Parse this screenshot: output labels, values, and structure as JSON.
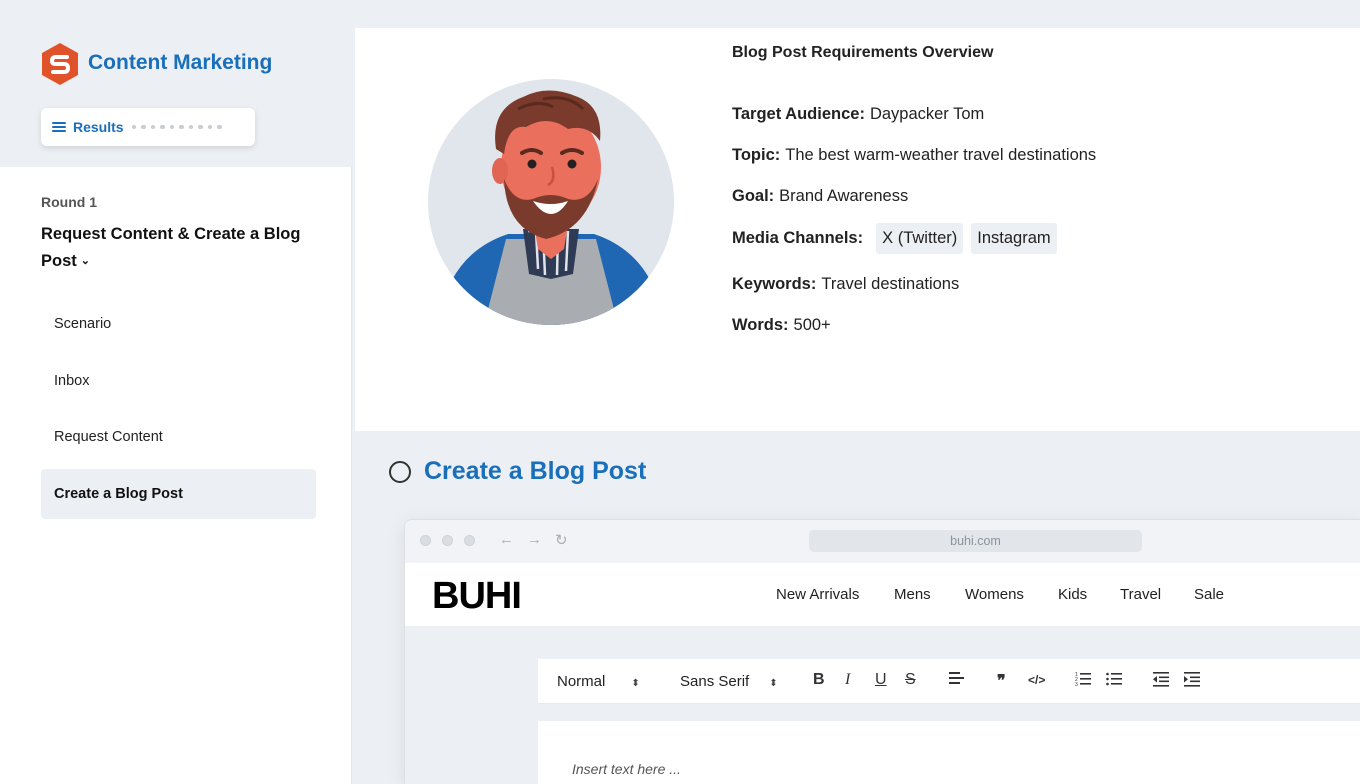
{
  "sidebar": {
    "app_title": "Content Marketing",
    "results_label": "Results",
    "round_label": "Round 1",
    "section_title": "Request Content & Create a Blog Post",
    "section_chevron": "⌄",
    "items": [
      {
        "label": "Scenario",
        "active": false
      },
      {
        "label": "Inbox",
        "active": false
      },
      {
        "label": "Request Content",
        "active": false
      },
      {
        "label": "Create a Blog Post",
        "active": true
      }
    ]
  },
  "requirements": {
    "title": "Blog Post Requirements Overview",
    "target_audience_label": "Target Audience:",
    "target_audience": "Daypacker Tom",
    "topic_label": "Topic:",
    "topic": "The best warm-weather travel destinations",
    "goal_label": "Goal:",
    "goal": "Brand Awareness",
    "media_label": "Media Channels:",
    "media_channels": [
      "X (Twitter)",
      "Instagram"
    ],
    "keywords_label": "Keywords:",
    "keywords": "Travel destinations",
    "words_label": "Words:",
    "words": "500+"
  },
  "task": {
    "title": "Create a Blog Post"
  },
  "browser": {
    "url": "buhi.com",
    "brand": "BUHI",
    "nav": [
      "New Arrivals",
      "Mens",
      "Womens",
      "Kids",
      "Travel",
      "Sale"
    ],
    "toolbar": {
      "format_select": "Normal",
      "font_select": "Sans Serif",
      "bold": "B",
      "italic": "I",
      "underline": "U",
      "strike": "S",
      "quote": "❞",
      "code": "</>"
    },
    "editor_placeholder": "Insert text here ..."
  },
  "colors": {
    "accent": "#1a6fba",
    "logo": "#e0532a",
    "background": "#eceff3"
  }
}
